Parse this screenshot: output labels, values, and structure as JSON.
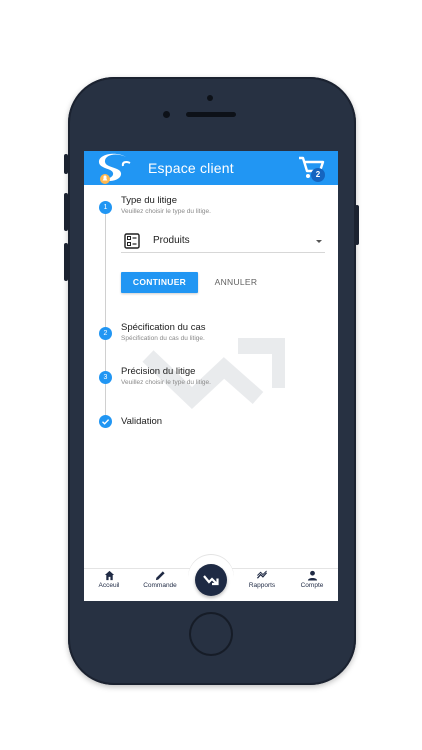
{
  "app": {
    "title": "Espace client",
    "cart_count": "2"
  },
  "steps": [
    {
      "number": "1",
      "title": "Type du litige",
      "subtitle": "Veuillez choisir le type du litige.",
      "state": "active"
    },
    {
      "number": "2",
      "title": "Spécification du cas",
      "subtitle": "Spécification du cas du litige.",
      "state": "pending"
    },
    {
      "number": "3",
      "title": "Précision du litige",
      "subtitle": "Veuillez choisir le type du litige.",
      "state": "pending"
    },
    {
      "number": "",
      "title": "Validation",
      "subtitle": "",
      "state": "done"
    }
  ],
  "form": {
    "select_value": "Produits",
    "select_icon": "list-icon",
    "continue_label": "CONTINUER",
    "cancel_label": "ANNULER"
  },
  "bottom_nav": [
    {
      "label": "Acceuil",
      "icon": "home-icon"
    },
    {
      "label": "Commande",
      "icon": "pencil-icon"
    },
    {
      "label": "",
      "icon": "trend-arrow-icon"
    },
    {
      "label": "Rapports",
      "icon": "chart-icon"
    },
    {
      "label": "Compte",
      "icon": "person-icon"
    }
  ],
  "colors": {
    "primary": "#2196f3",
    "dark": "#1e2a44",
    "phone": "#273142"
  }
}
